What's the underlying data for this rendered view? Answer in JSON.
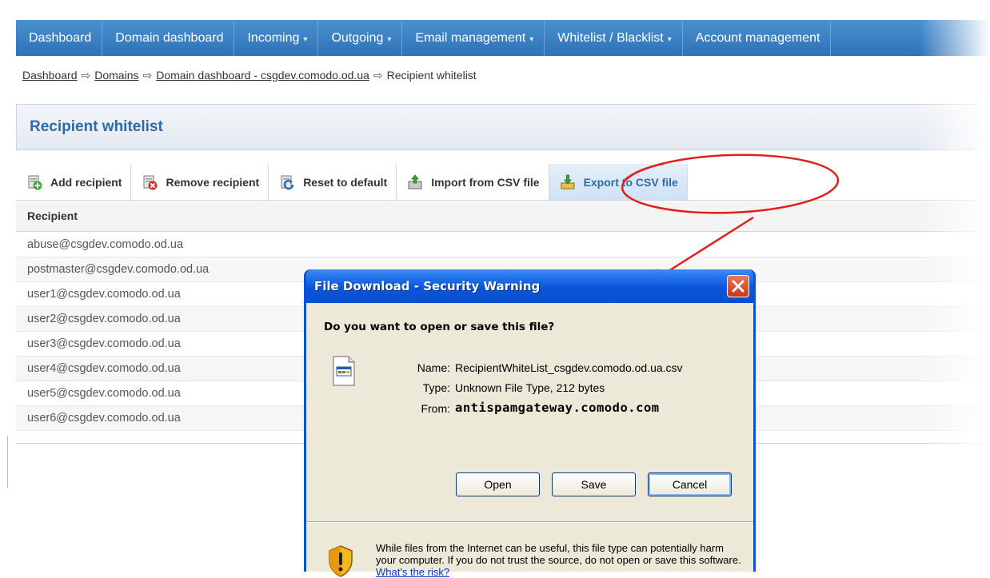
{
  "nav": {
    "items": [
      {
        "label": "Dashboard",
        "caret": ""
      },
      {
        "label": "Domain dashboard",
        "caret": ""
      },
      {
        "label": "Incoming",
        "caret": "▾"
      },
      {
        "label": "Outgoing",
        "caret": "▾"
      },
      {
        "label": "Email management",
        "caret": "▾"
      },
      {
        "label": "Whitelist / Blacklist",
        "caret": "▾"
      },
      {
        "label": "Account management",
        "caret": ""
      }
    ]
  },
  "breadcrumb": {
    "items": [
      "Dashboard",
      "Domains",
      "Domain dashboard - csgdev.comodo.od.ua"
    ],
    "current": "Recipient whitelist",
    "separator": "⇨"
  },
  "page": {
    "title": "Recipient whitelist"
  },
  "toolbar": {
    "add": "Add recipient",
    "remove": "Remove recipient",
    "reset": "Reset to default",
    "import": "Import from CSV file",
    "export": "Export to CSV file"
  },
  "table": {
    "header": "Recipient",
    "rows": [
      "abuse@csgdev.comodo.od.ua",
      "postmaster@csgdev.comodo.od.ua",
      "user1@csgdev.comodo.od.ua",
      "user2@csgdev.comodo.od.ua",
      "user3@csgdev.comodo.od.ua",
      "user4@csgdev.comodo.od.ua",
      "user5@csgdev.comodo.od.ua",
      "user6@csgdev.comodo.od.ua"
    ]
  },
  "dialog": {
    "title": "File Download - Security Warning",
    "question": "Do you want to open or save this file?",
    "name_label": "Name:",
    "name_value": "RecipientWhiteList_csgdev.comodo.od.ua.csv",
    "type_label": "Type:",
    "type_value": "Unknown File Type, 212 bytes",
    "from_label": "From:",
    "from_value": "antispamgateway.comodo.com",
    "buttons": {
      "open": "Open",
      "save": "Save",
      "cancel": "Cancel"
    },
    "warning_text": "While files from the Internet can be useful, this file type can potentially harm your computer. If you do not trust the source, do not open or save this software.",
    "risk_link": "What's the risk?"
  },
  "colors": {
    "nav_bg": "#3a80c4",
    "title": "#2e6aa6",
    "annotation": "#e0201a",
    "dialog_frame": "#0a53d8",
    "dialog_body": "#ece9d8"
  },
  "icons": [
    "add-user-icon",
    "remove-user-icon",
    "reset-icon",
    "import-csv-icon",
    "export-csv-icon",
    "close-icon",
    "file-icon",
    "shield-warning-icon"
  ]
}
